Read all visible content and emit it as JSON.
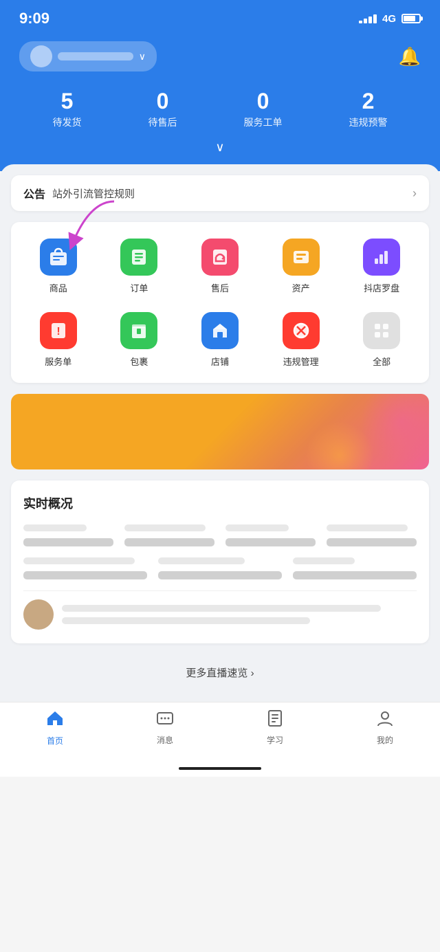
{
  "statusBar": {
    "time": "9:09",
    "signal": "4G"
  },
  "header": {
    "shopName": "",
    "bellLabel": "notifications",
    "stats": [
      {
        "key": "待发货",
        "value": "5"
      },
      {
        "key": "待售后",
        "value": "0"
      },
      {
        "key": "服务工单",
        "value": "0"
      },
      {
        "key": "违规预警",
        "value": "2"
      }
    ],
    "chevron": "∨"
  },
  "announcement": {
    "tag": "公告",
    "text": "站外引流管控规则",
    "arrow": "›"
  },
  "iconGrid": {
    "items": [
      {
        "id": "goods",
        "label": "商品",
        "color": "#2b7de9",
        "icon": "🛍"
      },
      {
        "id": "orders",
        "label": "订单",
        "color": "#34c759",
        "icon": "≡"
      },
      {
        "id": "aftersale",
        "label": "售后",
        "color": "#f44b6e",
        "icon": "↺"
      },
      {
        "id": "assets",
        "label": "资产",
        "color": "#f5a623",
        "icon": "▪"
      },
      {
        "id": "compass",
        "label": "抖店罗盘",
        "color": "#7c4dff",
        "icon": "📊"
      },
      {
        "id": "service",
        "label": "服务单",
        "color": "#ff3b30",
        "icon": "!"
      },
      {
        "id": "package",
        "label": "包裹",
        "color": "#34c759",
        "icon": "📦"
      },
      {
        "id": "shop",
        "label": "店铺",
        "color": "#2b7de9",
        "icon": "🏠"
      },
      {
        "id": "violation",
        "label": "违规管理",
        "color": "#ff3b30",
        "icon": "⊘"
      },
      {
        "id": "all",
        "label": "全部",
        "color": "#cccccc",
        "icon": "⊞"
      }
    ]
  },
  "realtime": {
    "title": "实时概况",
    "moreLink": "更多直播速览 ›"
  },
  "bottomNav": {
    "items": [
      {
        "id": "home",
        "label": "首页",
        "icon": "⌂",
        "active": true
      },
      {
        "id": "messages",
        "label": "消息",
        "icon": "💬",
        "active": false
      },
      {
        "id": "learn",
        "label": "学习",
        "icon": "📋",
        "active": false
      },
      {
        "id": "mine",
        "label": "我的",
        "icon": "👤",
        "active": false
      }
    ]
  }
}
